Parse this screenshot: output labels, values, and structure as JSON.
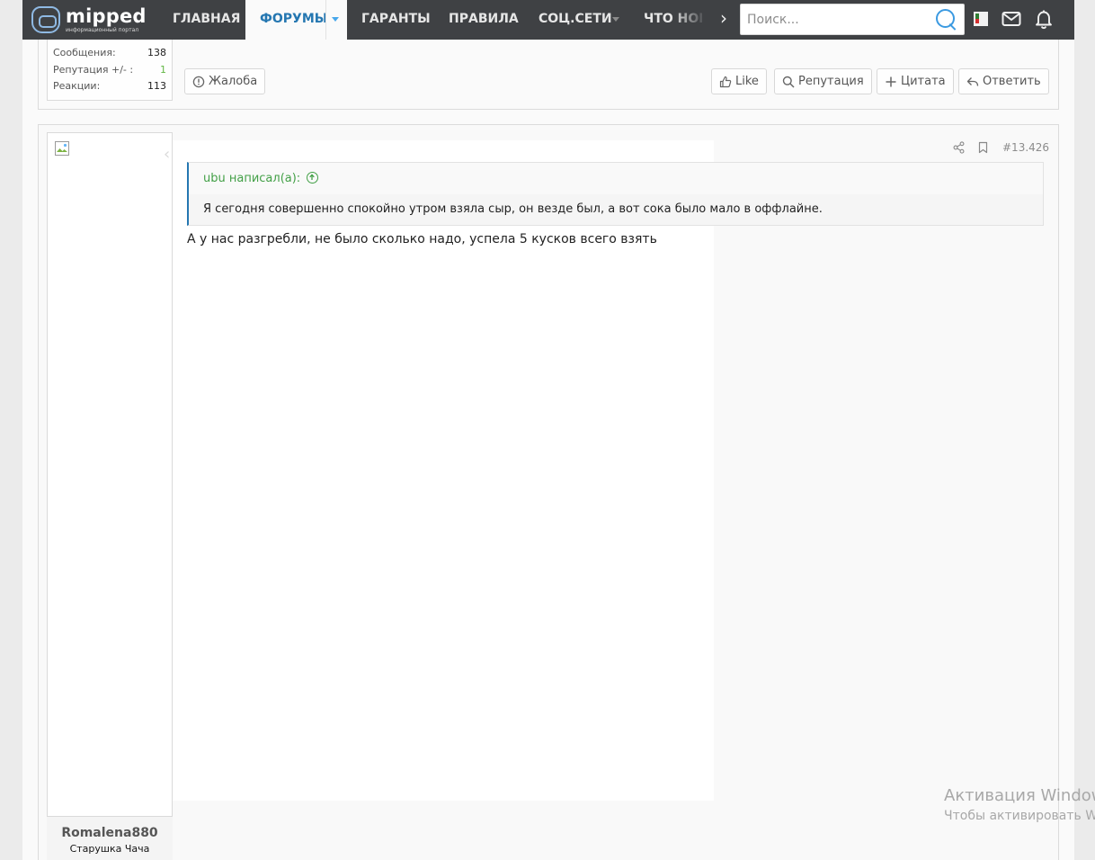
{
  "header": {
    "logo": {
      "brand": "mipped",
      "tagline": "информационный портал"
    },
    "nav": [
      {
        "label": "ГЛАВНАЯ"
      },
      {
        "label": "ФОРУМЫ",
        "active": true
      },
      {
        "label": "ГАРАНТЫ"
      },
      {
        "label": "ПРАВИЛА"
      },
      {
        "label": "СОЦ.СЕТИ"
      },
      {
        "label": "ЧТО НОВ"
      }
    ],
    "search_placeholder": "Поиск...",
    "icons": [
      "chat-flag-icon",
      "mail-icon",
      "bell-icon"
    ]
  },
  "prev_post": {
    "stats": [
      {
        "label": "Сообщения:",
        "value": "138"
      },
      {
        "label": "Репутация +/- :",
        "value": "1"
      },
      {
        "label": "Реакции:",
        "value": "113"
      }
    ],
    "report_label": "Жалоба",
    "actions": {
      "like": "Like",
      "reputation": "Репутация",
      "quote": "Цитата",
      "reply": "Ответить"
    }
  },
  "post": {
    "number": "#13.426",
    "quote_author": "ubu написал(а):",
    "quote_text": "Я сегодня совершенно спокойно утром взяла сыр, он везде был, а вот сока было мало в оффлайне.",
    "text": "А у нас разгребли, не было сколько надо, успела 5 кусков всего взять",
    "username": "Romalena880",
    "user_title": "Старушка Чача"
  },
  "watermark": {
    "line1": "Активация Windows",
    "line2": "Чтобы активировать Windows"
  },
  "colors": {
    "nav_bg": "#3f4144",
    "accent": "#2577b1",
    "quote_green": "#43a047"
  }
}
